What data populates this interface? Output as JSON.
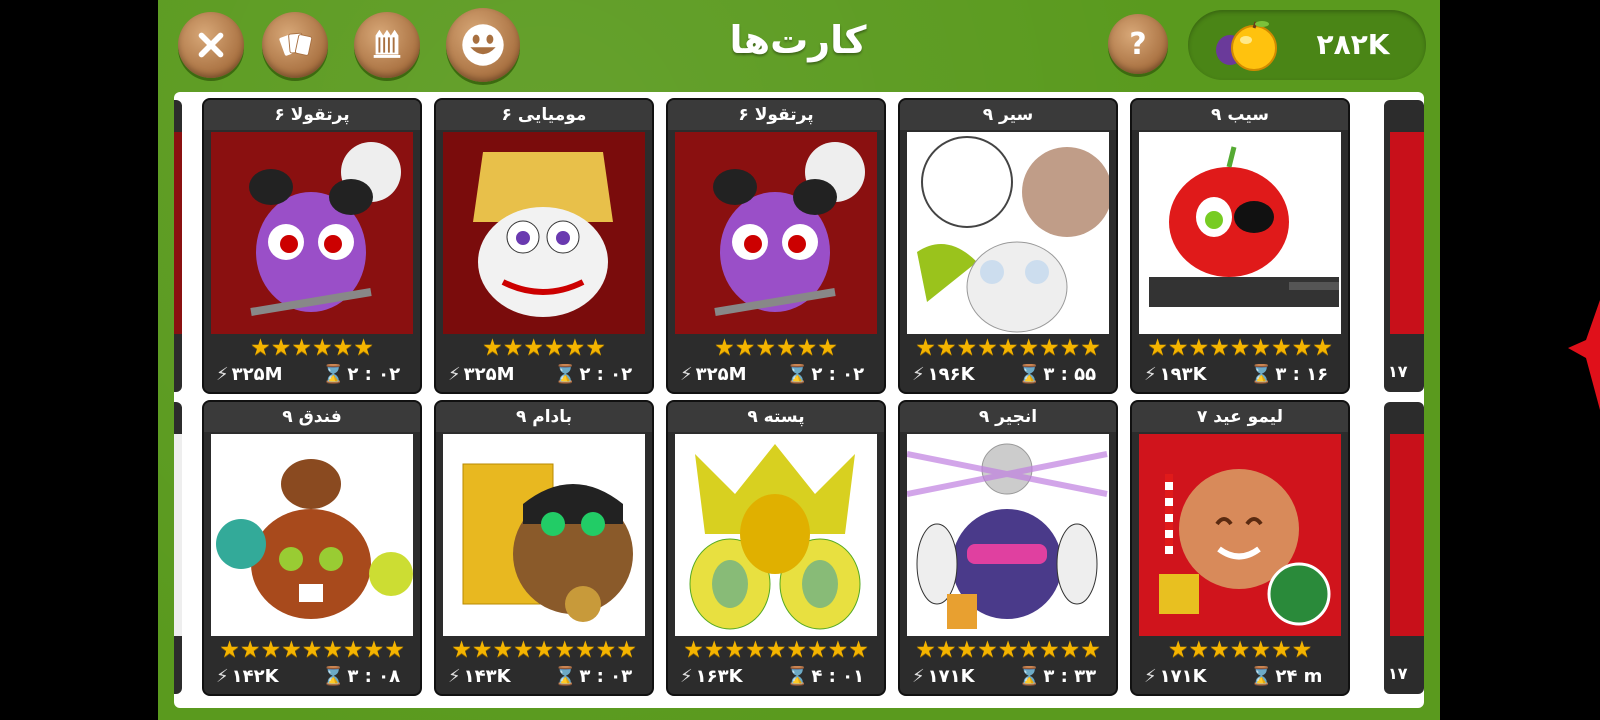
{
  "header": {
    "title": "کارت‌ها",
    "coins": "۲۸۲K"
  },
  "toolbar": {
    "close_icon": "close-icon",
    "cards_icon": "cards-icon",
    "packs_icon": "pack-icon",
    "smile_icon": "smile-icon",
    "help_label": "?"
  },
  "colors": {
    "background": "#5a9a1e",
    "card": "#2c2c2c",
    "star": "#f4b400",
    "button": "#a87040"
  },
  "cards_row1": [
    {
      "name": "پرتقولا ۶",
      "power": "۳۲۵M",
      "time": "۲ : ۰۲",
      "stars": 6,
      "art": "vampire"
    },
    {
      "name": "مومیایی ۶",
      "power": "۳۲۵M",
      "time": "۲ : ۰۲",
      "stars": 6,
      "art": "mummy"
    },
    {
      "name": "پرتقولا ۶",
      "power": "۳۲۵M",
      "time": "۲ : ۰۲",
      "stars": 6,
      "art": "vampire"
    },
    {
      "name": "سیر ۹",
      "power": "۱۹۶K",
      "time": "۳ : ۵۵",
      "stars": 9,
      "art": "garlic"
    },
    {
      "name": "سیب ۹",
      "power": "۱۹۳K",
      "time": "۳ : ۱۶",
      "stars": 9,
      "art": "apple"
    }
  ],
  "cards_row2": [
    {
      "name": "فندق ۹",
      "power": "۱۴۲K",
      "time": "۳ : ۰۸",
      "stars": 9,
      "art": "hazelnut"
    },
    {
      "name": "بادام ۹",
      "power": "۱۴۳K",
      "time": "۳ : ۰۳",
      "stars": 9,
      "art": "almond"
    },
    {
      "name": "پسته ۹",
      "power": "۱۶۳K",
      "time": "۴ : ۰۱",
      "stars": 9,
      "art": "pistachio"
    },
    {
      "name": "انجیر ۹",
      "power": "۱۷۱K",
      "time": "۳ : ۳۳",
      "stars": 9,
      "art": "fig"
    },
    {
      "name": "لیمو عید ۷",
      "power": "۱۷۱K",
      "time": "۲۴ m",
      "stars": 7,
      "art": "xmas"
    }
  ],
  "edge_cards": {
    "right_top_power": "۱۷",
    "right_bottom_power": "۱۷"
  }
}
